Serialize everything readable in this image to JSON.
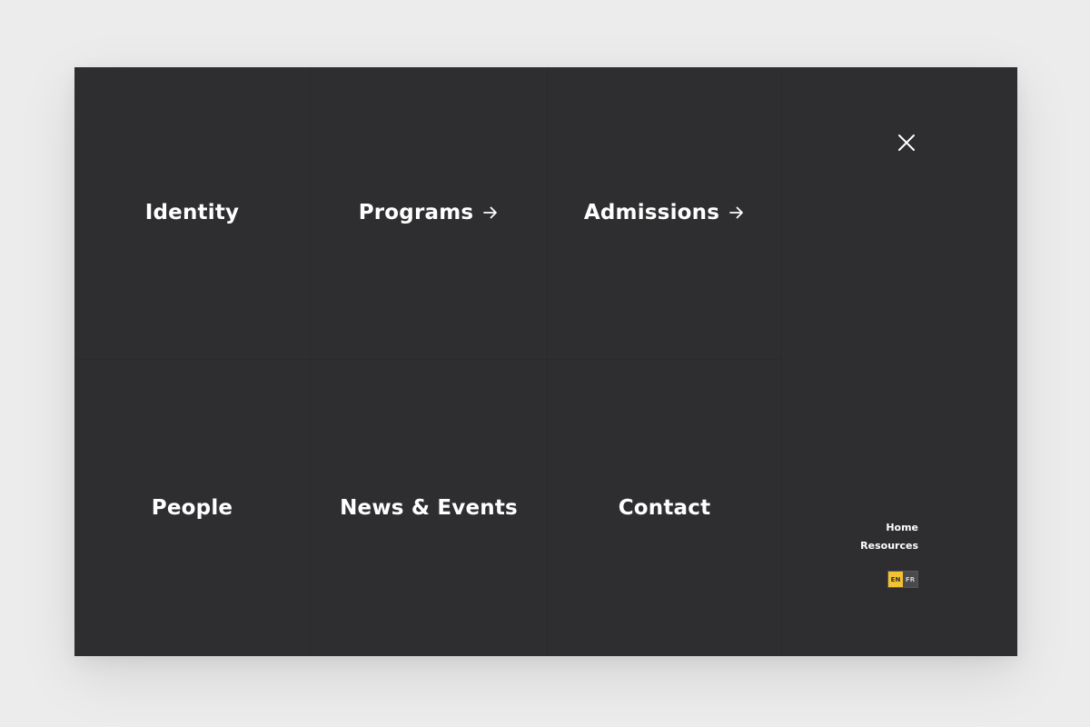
{
  "menu": {
    "items": [
      {
        "label": "Identity",
        "has_arrow": false
      },
      {
        "label": "Programs",
        "has_arrow": true
      },
      {
        "label": "Admissions",
        "has_arrow": true
      },
      {
        "label": "People",
        "has_arrow": false
      },
      {
        "label": "News & Events",
        "has_arrow": false
      },
      {
        "label": "Contact",
        "has_arrow": false
      }
    ],
    "arrow_icon": "arrow-right-icon"
  },
  "side": {
    "close_icon": "close-icon",
    "links": [
      {
        "label": "Home"
      },
      {
        "label": "Resources"
      }
    ],
    "languages": [
      {
        "code": "EN",
        "active": true
      },
      {
        "code": "FR",
        "active": false
      }
    ]
  },
  "colors": {
    "panel_background": "#2e2e30",
    "page_background": "#ececec",
    "accent": "#f2c232",
    "text": "#ffffff"
  }
}
